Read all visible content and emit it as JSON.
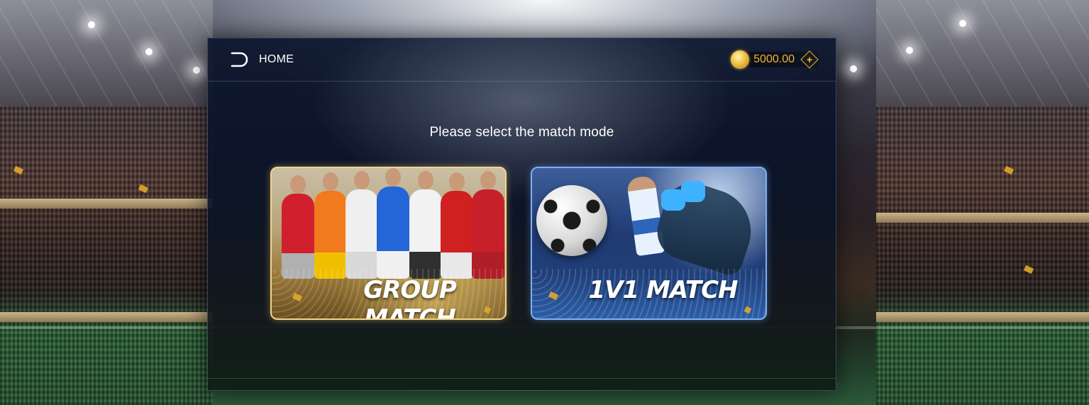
{
  "topbar": {
    "home_label": "HOME",
    "coins": "5000.00",
    "add_coins_symbol": "+"
  },
  "prompt": "Please select the match mode",
  "modes": [
    {
      "id": "group",
      "label": "GROUP MATCH"
    },
    {
      "id": "1v1",
      "label": "1V1 MATCH"
    }
  ],
  "colors": {
    "coin_text": "#f5b52a",
    "group_border": "#f1d58a",
    "onevone_border": "#7fb0f0"
  },
  "icons": {
    "back": "back-arrow-icon",
    "coin": "gold-coin-icon",
    "add": "plus-diamond-icon"
  }
}
